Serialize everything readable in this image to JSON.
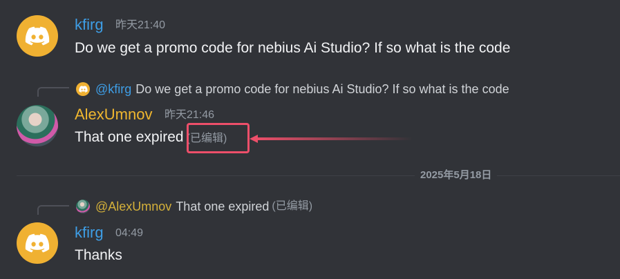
{
  "messages": [
    {
      "username": "kfirg",
      "timestamp": "昨天21:40",
      "content": "Do we get a promo code for nebius Ai Studio? If so what is the code",
      "avatar": "discord-logo-icon"
    },
    {
      "reply": {
        "username": "@kfirg",
        "text": "Do we get a promo code for nebius Ai Studio? If so what is the code"
      },
      "username": "AlexUmnov",
      "timestamp": "昨天21:46",
      "content": "That one expired",
      "edited": "(已编辑)",
      "avatar": "user-photo"
    },
    {
      "reply": {
        "username": "@AlexUmnov",
        "text": "That one expired",
        "edited": "(已编辑)"
      },
      "username": "kfirg",
      "timestamp": "04:49",
      "content": "Thanks",
      "avatar": "discord-logo-icon"
    }
  ],
  "date_divider": "2025年5月18日",
  "colors": {
    "background": "#313338",
    "username_blue": "#3e9ee6",
    "username_gold": "#f0b72f",
    "discord_avatar": "#f0b132",
    "annotation": "#ed4f6a"
  }
}
